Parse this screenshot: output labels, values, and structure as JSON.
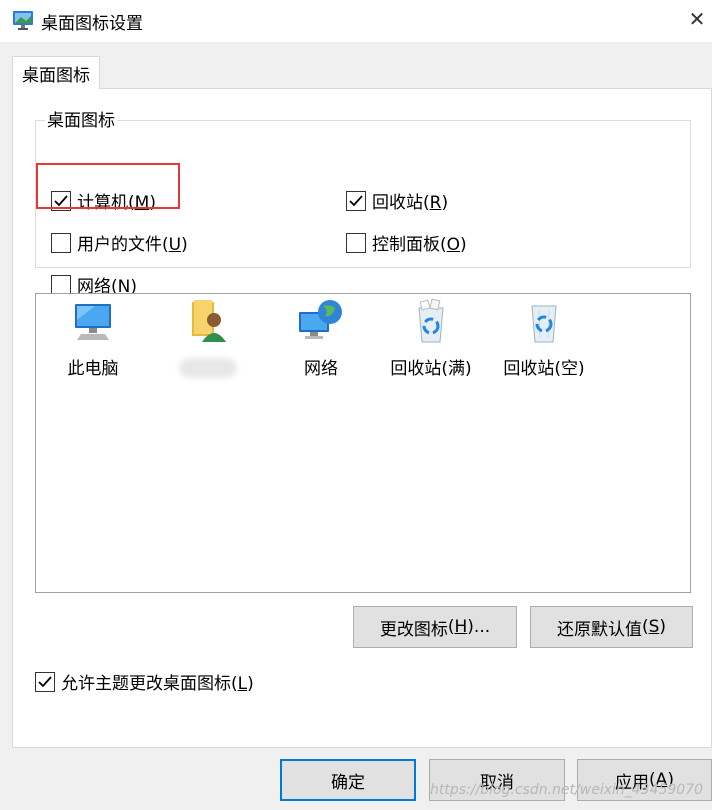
{
  "window": {
    "title": "桌面图标设置",
    "close_glyph": "✕"
  },
  "tabs": [
    {
      "label": "桌面图标",
      "selected": true
    }
  ],
  "group": {
    "label": "桌面图标",
    "checkboxes": [
      {
        "label": "计算机",
        "accel": "M",
        "checked": true,
        "highlighted": true
      },
      {
        "label": "回收站",
        "accel": "R",
        "checked": true
      },
      {
        "label": "用户的文件",
        "accel": "U",
        "checked": false
      },
      {
        "label": "控制面板",
        "accel": "O",
        "checked": false
      },
      {
        "label": "网络",
        "accel": "N",
        "checked": false
      }
    ]
  },
  "icons": [
    {
      "label": "此电脑",
      "icon": "computer-icon"
    },
    {
      "label": "",
      "icon": "user-folder-icon",
      "label_obscured": true
    },
    {
      "label": "网络",
      "icon": "network-icon"
    },
    {
      "label": "回收站(满)",
      "icon": "recycle-bin-full-icon"
    },
    {
      "label": "回收站(空)",
      "icon": "recycle-bin-empty-icon"
    }
  ],
  "buttons": {
    "change_icon": {
      "label": "更改图标",
      "accel": "H",
      "suffix": "..."
    },
    "restore_default": {
      "label": "还原默认值",
      "accel": "S"
    }
  },
  "allow_themes": {
    "label": "允许主题更改桌面图标",
    "accel": "L",
    "checked": true
  },
  "footer": {
    "ok": "确定",
    "cancel": "取消",
    "apply": {
      "label": "应用",
      "accel": "A"
    }
  },
  "watermark": "https://blog.csdn.net/weixin_43459070",
  "colors": {
    "highlight_border": "#e53935",
    "focus_border": "#0078d7",
    "body_bg": "#f0f0f0"
  }
}
